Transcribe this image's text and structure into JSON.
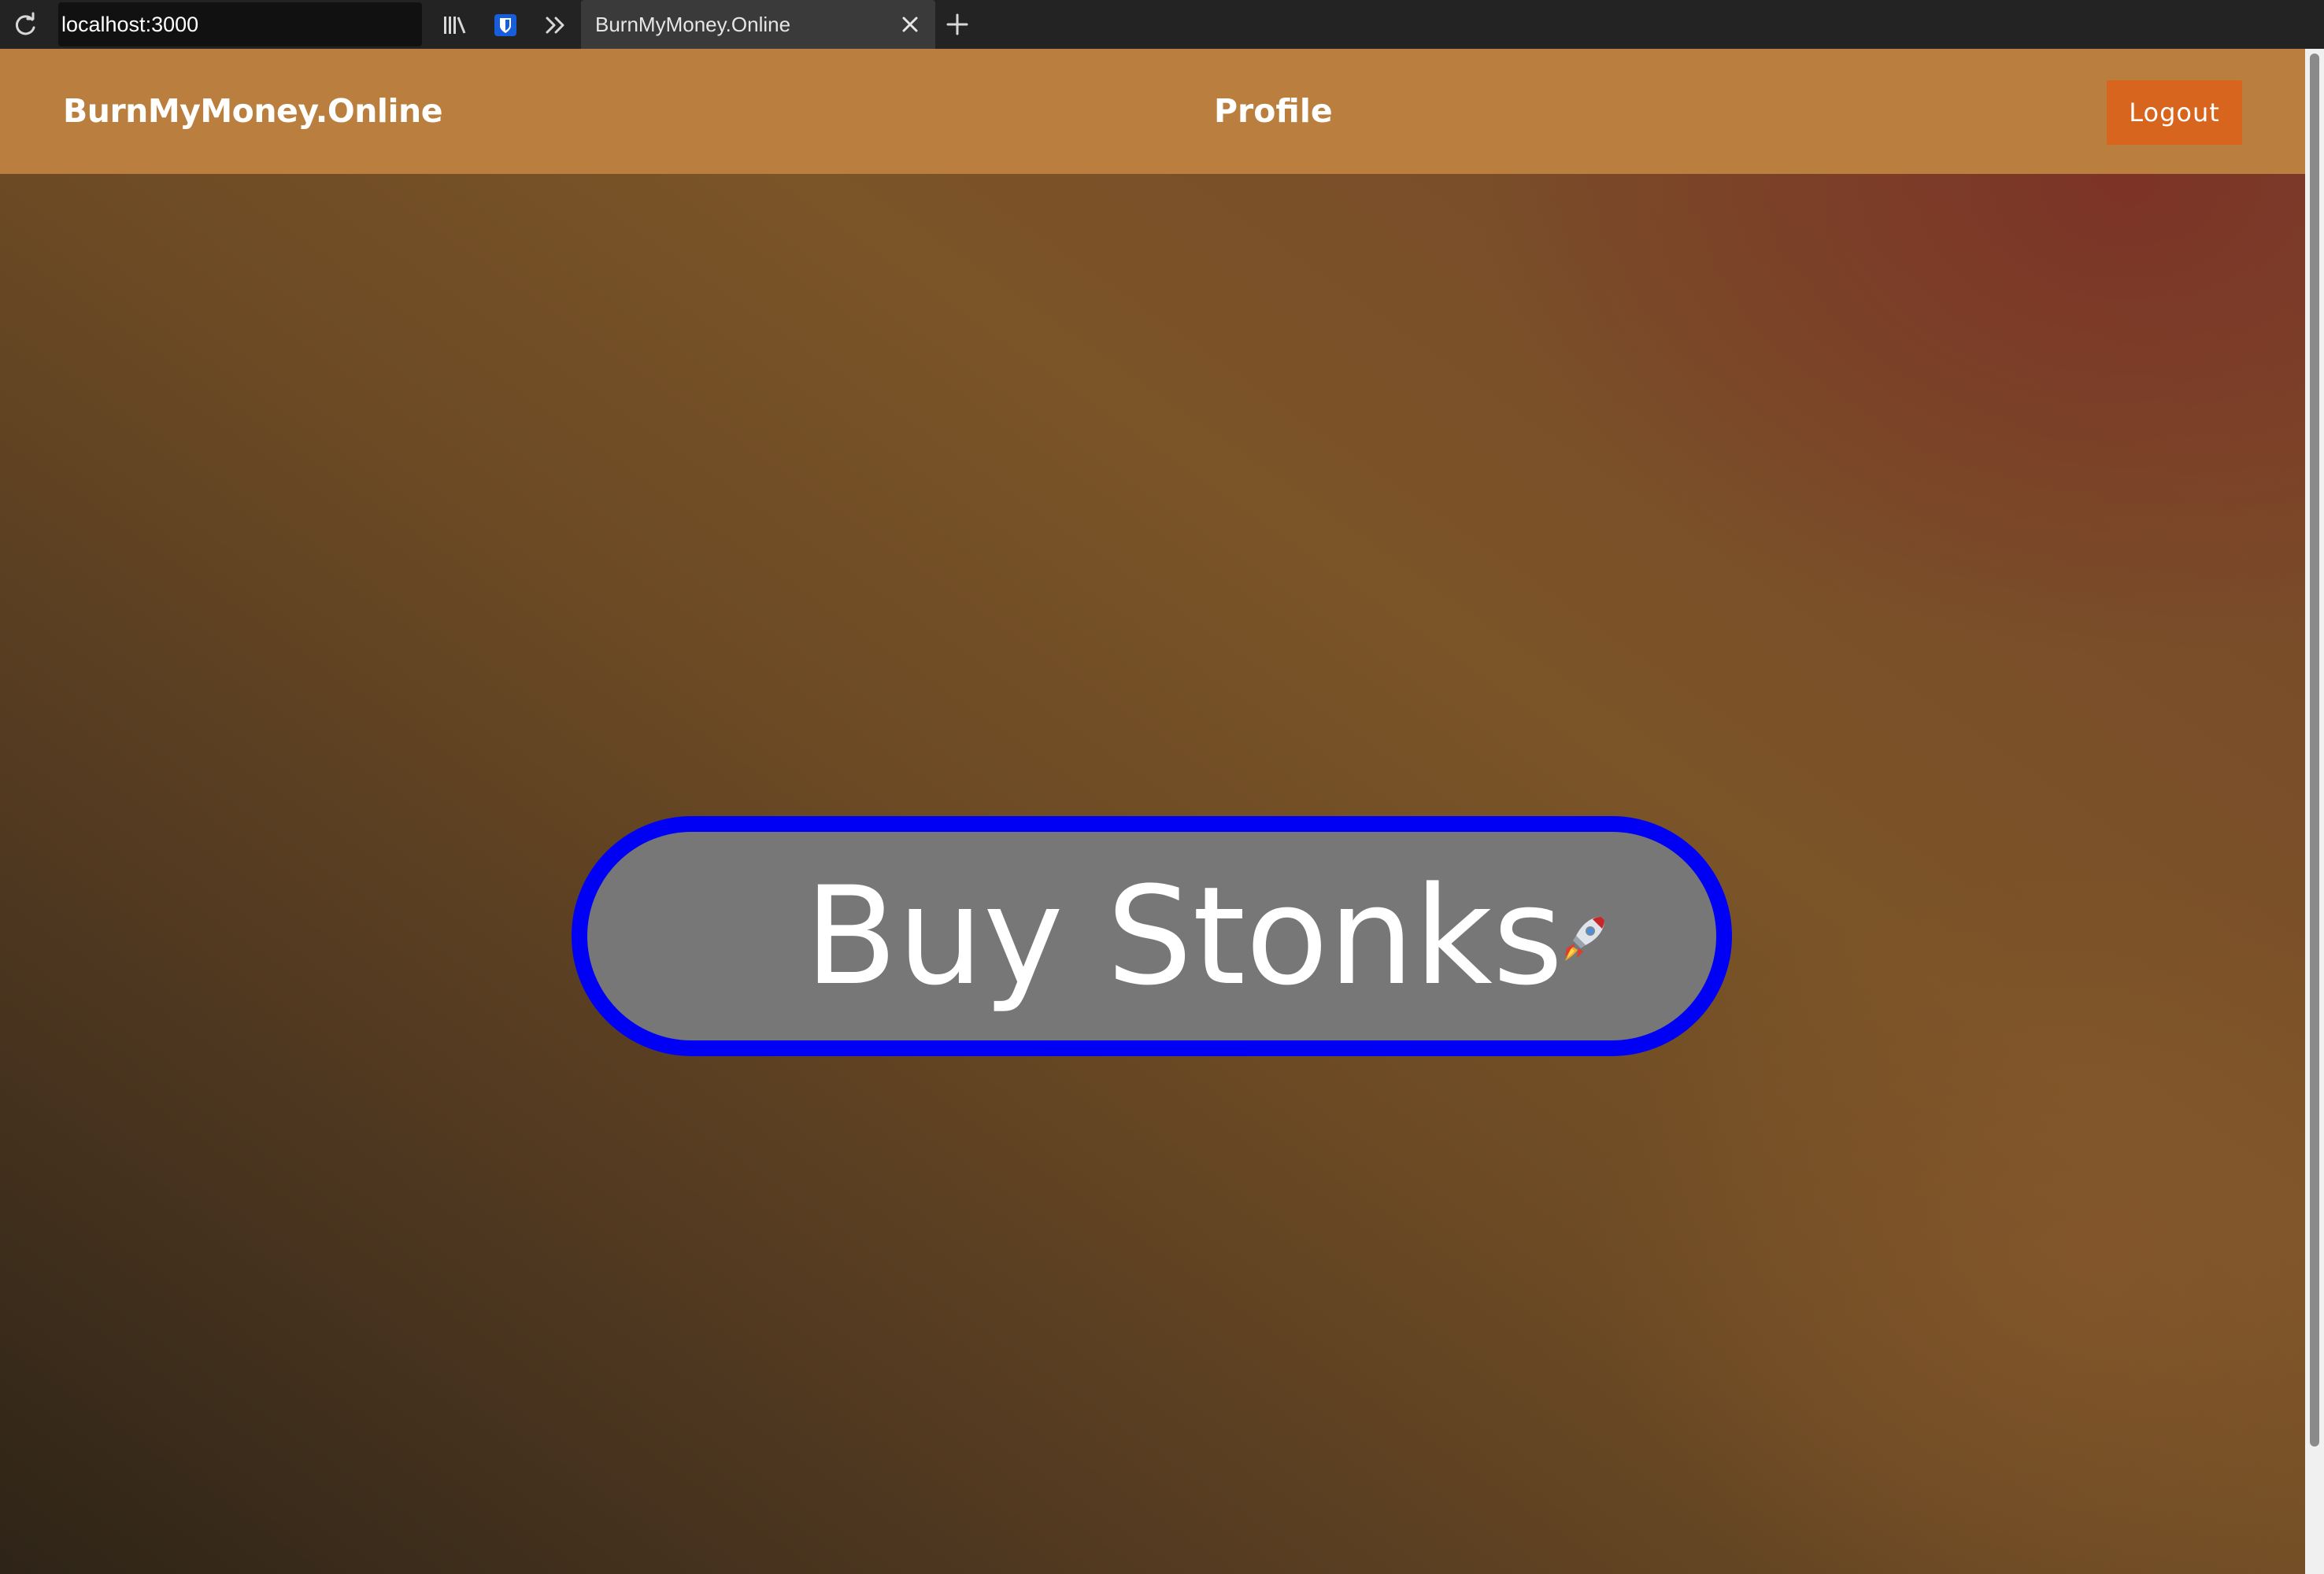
{
  "browser": {
    "url": "localhost:3000",
    "tab_title": "BurnMyMoney.Online",
    "toolbar_icons": [
      "reload-icon",
      "library-icon",
      "bitwarden-icon",
      "overflow-chevron-icon",
      "close-icon",
      "plus-icon"
    ]
  },
  "header": {
    "brand": "BurnMyMoney.Online",
    "nav_profile": "Profile",
    "logout_label": "Logout"
  },
  "main": {
    "cta_label": "Buy Stonks",
    "cta_icon": "rocket-icon"
  },
  "colors": {
    "header_bg": "#ba7f3e",
    "logout_bg": "#d7651d",
    "cta_bg": "#777777",
    "cta_border": "#0000f5"
  }
}
